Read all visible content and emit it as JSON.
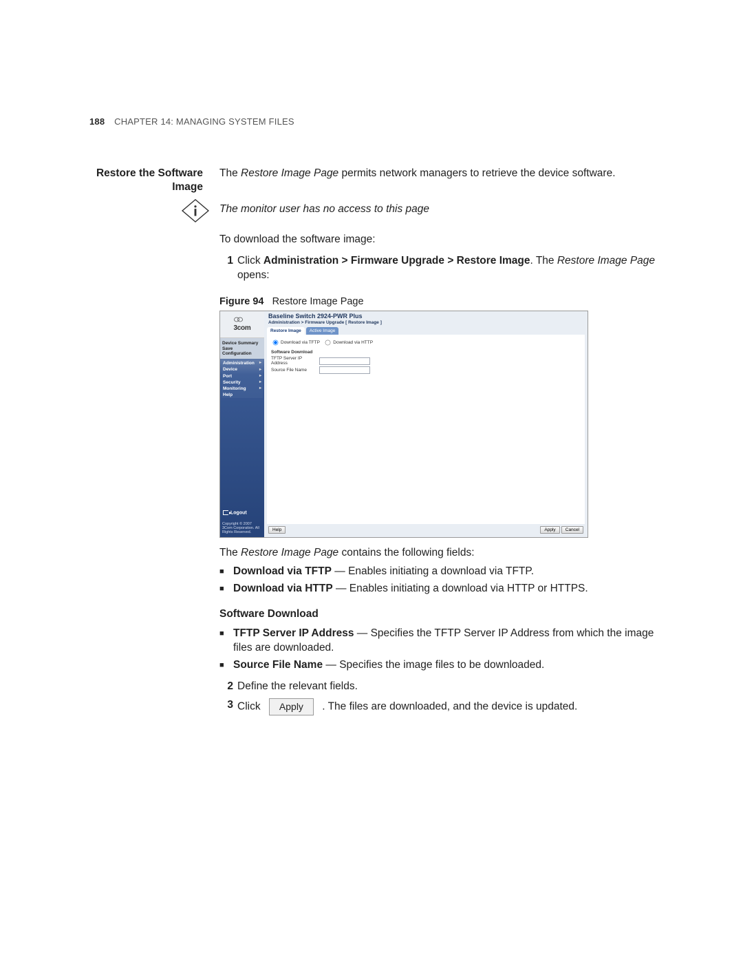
{
  "header": {
    "page_number": "188",
    "chapter_prefix": "C",
    "chapter_word_rest": "HAPTER",
    "chapter_num": " 14: M",
    "chapter_title_rest": "ANAGING",
    "chapter_s": " S",
    "chapter_sys": "YSTEM",
    "chapter_f": " F",
    "chapter_files": "ILES"
  },
  "section_title_1": "Restore the Software",
  "section_title_2": "Image",
  "intro_1a": "The ",
  "intro_1b": "Restore Image Page",
  "intro_1c": " permits network managers to retrieve the device software.",
  "note_text": "The monitor user has no access to this page",
  "intro_2": "To download the software image:",
  "steps": {
    "s1_a": "Click ",
    "s1_b": "Administration > Firmware Upgrade > Restore Image",
    "s1_c": ". The ",
    "s1_d": "Restore Image Page",
    "s1_e": " opens:",
    "s2": "Define the relevant fields.",
    "s3_a": "Click",
    "s3_btn": "Apply",
    "s3_b": ". The files are downloaded, and the device is updated."
  },
  "figure": {
    "label": "Figure 94",
    "caption": "Restore Image Page"
  },
  "fb": {
    "logo": "3com",
    "side_top": [
      "Device Summary",
      "Save Configuration"
    ],
    "menu": [
      "Administration",
      "Device",
      "Port",
      "Security",
      "Monitoring",
      "Help"
    ],
    "logout": "Logout",
    "copyright": "Copyright © 2007 3Com Corporation. All Rights Reserved.",
    "title": "Baseline Switch 2924-PWR Plus",
    "breadcrumb": "Administration > Firmware Upgrade [ Restore Image ]",
    "tab_active": "Restore Image",
    "tab_inactive": "Active Image",
    "radio_tftp": "Download via TFTP",
    "radio_http": "Download via HTTP",
    "dl_section": "Software Download",
    "field1": "TFTP Server IP Address",
    "field2": "Source File Name",
    "btn_help": "Help",
    "btn_apply": "Apply",
    "btn_cancel": "Cancel"
  },
  "after": {
    "contains": "The ",
    "contains_i": "Restore Image Page",
    "contains_b": " contains the following fields:",
    "b1_a": "Download via TFTP",
    "b1_b": " — Enables initiating a download via TFTP.",
    "b2_a": "Download via HTTP",
    "b2_b": " — Enables initiating a download via HTTP or HTTPS.",
    "subhead": "Software Download",
    "b3_a": "TFTP Server IP Address",
    "b3_b": " — Specifies the TFTP Server IP Address from which the image files are downloaded.",
    "b4_a": "Source File Name",
    "b4_b": " — Specifies the image files to be downloaded."
  }
}
